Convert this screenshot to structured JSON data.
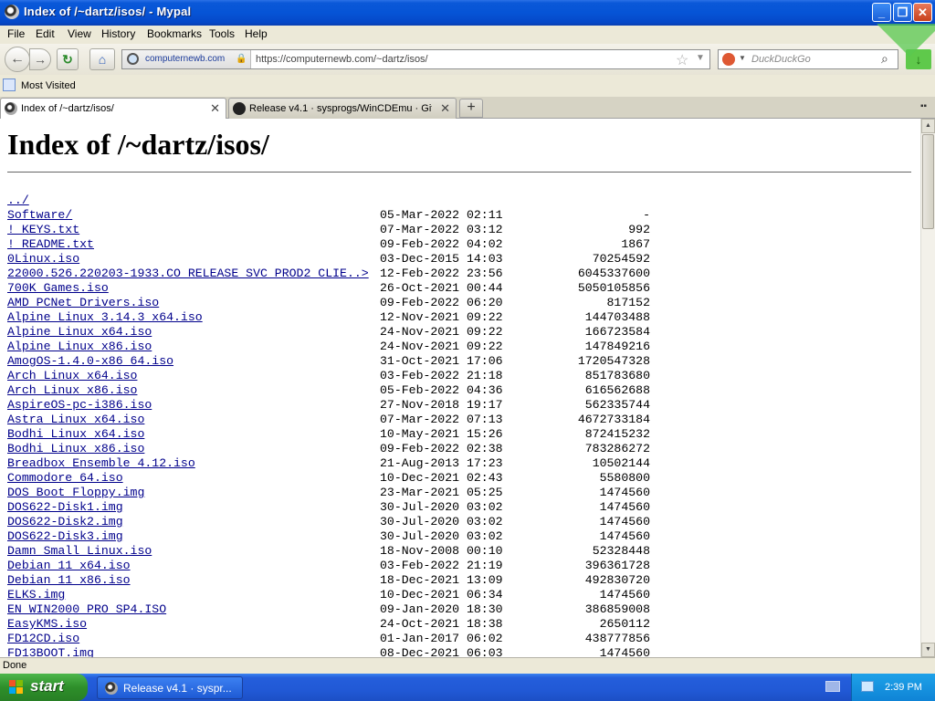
{
  "window": {
    "title": "Index of /~dartz/isos/ - Mypal"
  },
  "menu": [
    "File",
    "Edit",
    "View",
    "History",
    "Bookmarks",
    "Tools",
    "Help"
  ],
  "nav": {
    "site_domain": "computernewb.com",
    "url": "https://computernewb.com/~dartz/isos/",
    "search_placeholder": "DuckDuckGo"
  },
  "bookmarks": {
    "most_visited": "Most Visited"
  },
  "tabs": [
    {
      "label": "Index of /~dartz/isos/",
      "active": true
    },
    {
      "label": "Release v4.1 · sysprogs/WinCDEmu · Git...",
      "active": false
    }
  ],
  "page": {
    "heading": "Index of /~dartz/isos/",
    "parent_link": "../",
    "entries": [
      {
        "name": "Software/",
        "date": "05-Mar-2022 02:11",
        "size": "-"
      },
      {
        "name": "! KEYS.txt",
        "date": "07-Mar-2022 03:12",
        "size": "992"
      },
      {
        "name": "! README.txt",
        "date": "09-Feb-2022 04:02",
        "size": "1867"
      },
      {
        "name": "0Linux.iso",
        "date": "03-Dec-2015 14:03",
        "size": "70254592"
      },
      {
        "name": "22000.526.220203-1933.CO RELEASE SVC PROD2 CLIE..>",
        "date": "12-Feb-2022 23:56",
        "size": "6045337600"
      },
      {
        "name": "700K Games.iso",
        "date": "26-Oct-2021 00:44",
        "size": "5050105856"
      },
      {
        "name": "AMD PCNet Drivers.iso",
        "date": "09-Feb-2022 06:20",
        "size": "817152"
      },
      {
        "name": "Alpine Linux 3.14.3 x64.iso",
        "date": "12-Nov-2021 09:22",
        "size": "144703488"
      },
      {
        "name": "Alpine Linux x64.iso",
        "date": "24-Nov-2021 09:22",
        "size": "166723584"
      },
      {
        "name": "Alpine Linux x86.iso",
        "date": "24-Nov-2021 09:22",
        "size": "147849216"
      },
      {
        "name": "AmogOS-1.4.0-x86 64.iso",
        "date": "31-Oct-2021 17:06",
        "size": "1720547328"
      },
      {
        "name": "Arch Linux x64.iso",
        "date": "03-Feb-2022 21:18",
        "size": "851783680"
      },
      {
        "name": "Arch Linux x86.iso",
        "date": "05-Feb-2022 04:36",
        "size": "616562688"
      },
      {
        "name": "AspireOS-pc-i386.iso",
        "date": "27-Nov-2018 19:17",
        "size": "562335744"
      },
      {
        "name": "Astra Linux x64.iso",
        "date": "07-Mar-2022 07:13",
        "size": "4672733184"
      },
      {
        "name": "Bodhi Linux x64.iso",
        "date": "10-May-2021 15:26",
        "size": "872415232"
      },
      {
        "name": "Bodhi Linux x86.iso",
        "date": "09-Feb-2022 02:38",
        "size": "783286272"
      },
      {
        "name": "Breadbox Ensemble 4.12.iso",
        "date": "21-Aug-2013 17:23",
        "size": "10502144"
      },
      {
        "name": "Commodore 64.iso",
        "date": "10-Dec-2021 02:43",
        "size": "5580800"
      },
      {
        "name": "DOS Boot Floppy.img",
        "date": "23-Mar-2021 05:25",
        "size": "1474560"
      },
      {
        "name": "DOS622-Disk1.img",
        "date": "30-Jul-2020 03:02",
        "size": "1474560"
      },
      {
        "name": "DOS622-Disk2.img",
        "date": "30-Jul-2020 03:02",
        "size": "1474560"
      },
      {
        "name": "DOS622-Disk3.img",
        "date": "30-Jul-2020 03:02",
        "size": "1474560"
      },
      {
        "name": "Damn Small Linux.iso",
        "date": "18-Nov-2008 00:10",
        "size": "52328448"
      },
      {
        "name": "Debian 11 x64.iso",
        "date": "03-Feb-2022 21:19",
        "size": "396361728"
      },
      {
        "name": "Debian 11 x86.iso",
        "date": "18-Dec-2021 13:09",
        "size": "492830720"
      },
      {
        "name": "ELKS.img",
        "date": "10-Dec-2021 06:34",
        "size": "1474560"
      },
      {
        "name": "EN WIN2000 PRO SP4.ISO",
        "date": "09-Jan-2020 18:30",
        "size": "386859008"
      },
      {
        "name": "EasyKMS.iso",
        "date": "24-Oct-2021 18:38",
        "size": "2650112"
      },
      {
        "name": "FD12CD.iso",
        "date": "01-Jan-2017 06:02",
        "size": "438777856"
      },
      {
        "name": "FD13BOOT.img",
        "date": "08-Dec-2021 06:03",
        "size": "1474560"
      }
    ]
  },
  "status": {
    "text": "Done"
  },
  "taskbar": {
    "start_label": "start",
    "task_label": "Release v4.1 · syspr...",
    "clock": "2:39 PM"
  },
  "colors": {
    "link": "#00008b",
    "titlebar": "#0654d6",
    "taskbar": "#245edb",
    "start": "#2e8f2a"
  }
}
